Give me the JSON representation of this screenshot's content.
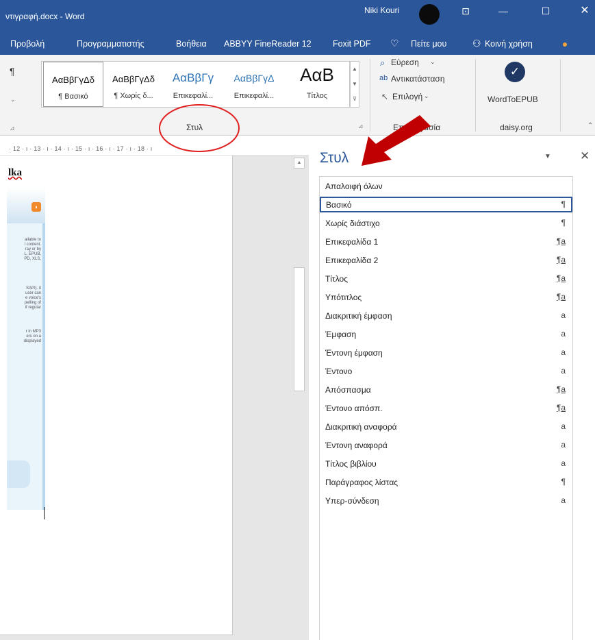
{
  "titlebar": {
    "doc_title": "ντιγραφή.docx - Word",
    "user_name": "Niki Kouri",
    "ribbon_display_icon": "ribbon-display-options-icon",
    "minimize_icon": "minimize-icon",
    "maximize_icon": "maximize-icon",
    "close_icon": "close-icon"
  },
  "menu": {
    "items": [
      "Προβολή",
      "Προγραμματιστής",
      "Βοήθεια",
      "ABBYY FineReader 12",
      "Foxit PDF"
    ],
    "tell_me": "Πείτε μου",
    "share": "Κοινή χρήση"
  },
  "ribbon": {
    "paragraph_mark": "¶",
    "styles_gallery": [
      {
        "preview": "ΑαΒβΓγΔδ",
        "name": "¶ Βασικό",
        "selected": true
      },
      {
        "preview": "ΑαΒβΓγΔδ",
        "name": "¶ Χωρίς δ...",
        "selected": false
      },
      {
        "preview": "ΑαΒβΓγ",
        "name": "Επικεφαλί...",
        "selected": false
      },
      {
        "preview": "ΑαΒβΓγΔ",
        "name": "Επικεφαλί...",
        "selected": false
      },
      {
        "preview": "ΑαΒ",
        "name": "Τίτλος",
        "selected": false
      }
    ],
    "styles_group_label": "Στυλ",
    "find": "Εύρεση",
    "replace": "Αντικατάσταση",
    "select": "Επιλογή",
    "editing_group_label": "Επεξεργασία",
    "wordtoepub": "WordToEPUB",
    "daisy_group_label": "daisy.org"
  },
  "ruler": {
    "numbers": "· 12 · ı · 13 · ı · 14 · ı · 15 · ı · 16 · ı · 17 · ı · 18 · ı"
  },
  "document": {
    "heading_fragment": "lka",
    "para1": "ailable to\nl content.\nray or by\nL, EPUB,\nPD, XLS,",
    "para2": "SAPI). it\nuser can\ne voice's\npelling of\nif regular",
    "para3": "r in MP3\ners on a\ndisplayed"
  },
  "styles_pane": {
    "title": "Στυλ",
    "styles": [
      {
        "name": "Απαλοιφή όλων",
        "icon": ""
      },
      {
        "name": "Βασικό",
        "icon": "¶",
        "selected": true
      },
      {
        "name": "Χωρίς διάστιχο",
        "icon": "¶"
      },
      {
        "name": "Επικεφαλίδα 1",
        "icon": "¶a"
      },
      {
        "name": "Επικεφαλίδα 2",
        "icon": "¶a"
      },
      {
        "name": "Τίτλος",
        "icon": "¶a"
      },
      {
        "name": "Υπότιτλος",
        "icon": "¶a"
      },
      {
        "name": "Διακριτική έμφαση",
        "icon": "a"
      },
      {
        "name": "Έμφαση",
        "icon": "a"
      },
      {
        "name": "Έντονη έμφαση",
        "icon": "a"
      },
      {
        "name": "Έντονο",
        "icon": "a"
      },
      {
        "name": "Απόσπασμα",
        "icon": "¶a"
      },
      {
        "name": "Έντονο απόσπ.",
        "icon": "¶a"
      },
      {
        "name": "Διακριτική αναφορά",
        "icon": "a"
      },
      {
        "name": "Έντονη αναφορά",
        "icon": "a"
      },
      {
        "name": "Τίτλος βιβλίου",
        "icon": "a"
      },
      {
        "name": "Παράγραφος λίστας",
        "icon": "¶"
      },
      {
        "name": "Υπερ-σύνδεση",
        "icon": "a"
      }
    ]
  },
  "annotations": {
    "circle_color": "#e02020",
    "arrow_color": "#c00000"
  }
}
